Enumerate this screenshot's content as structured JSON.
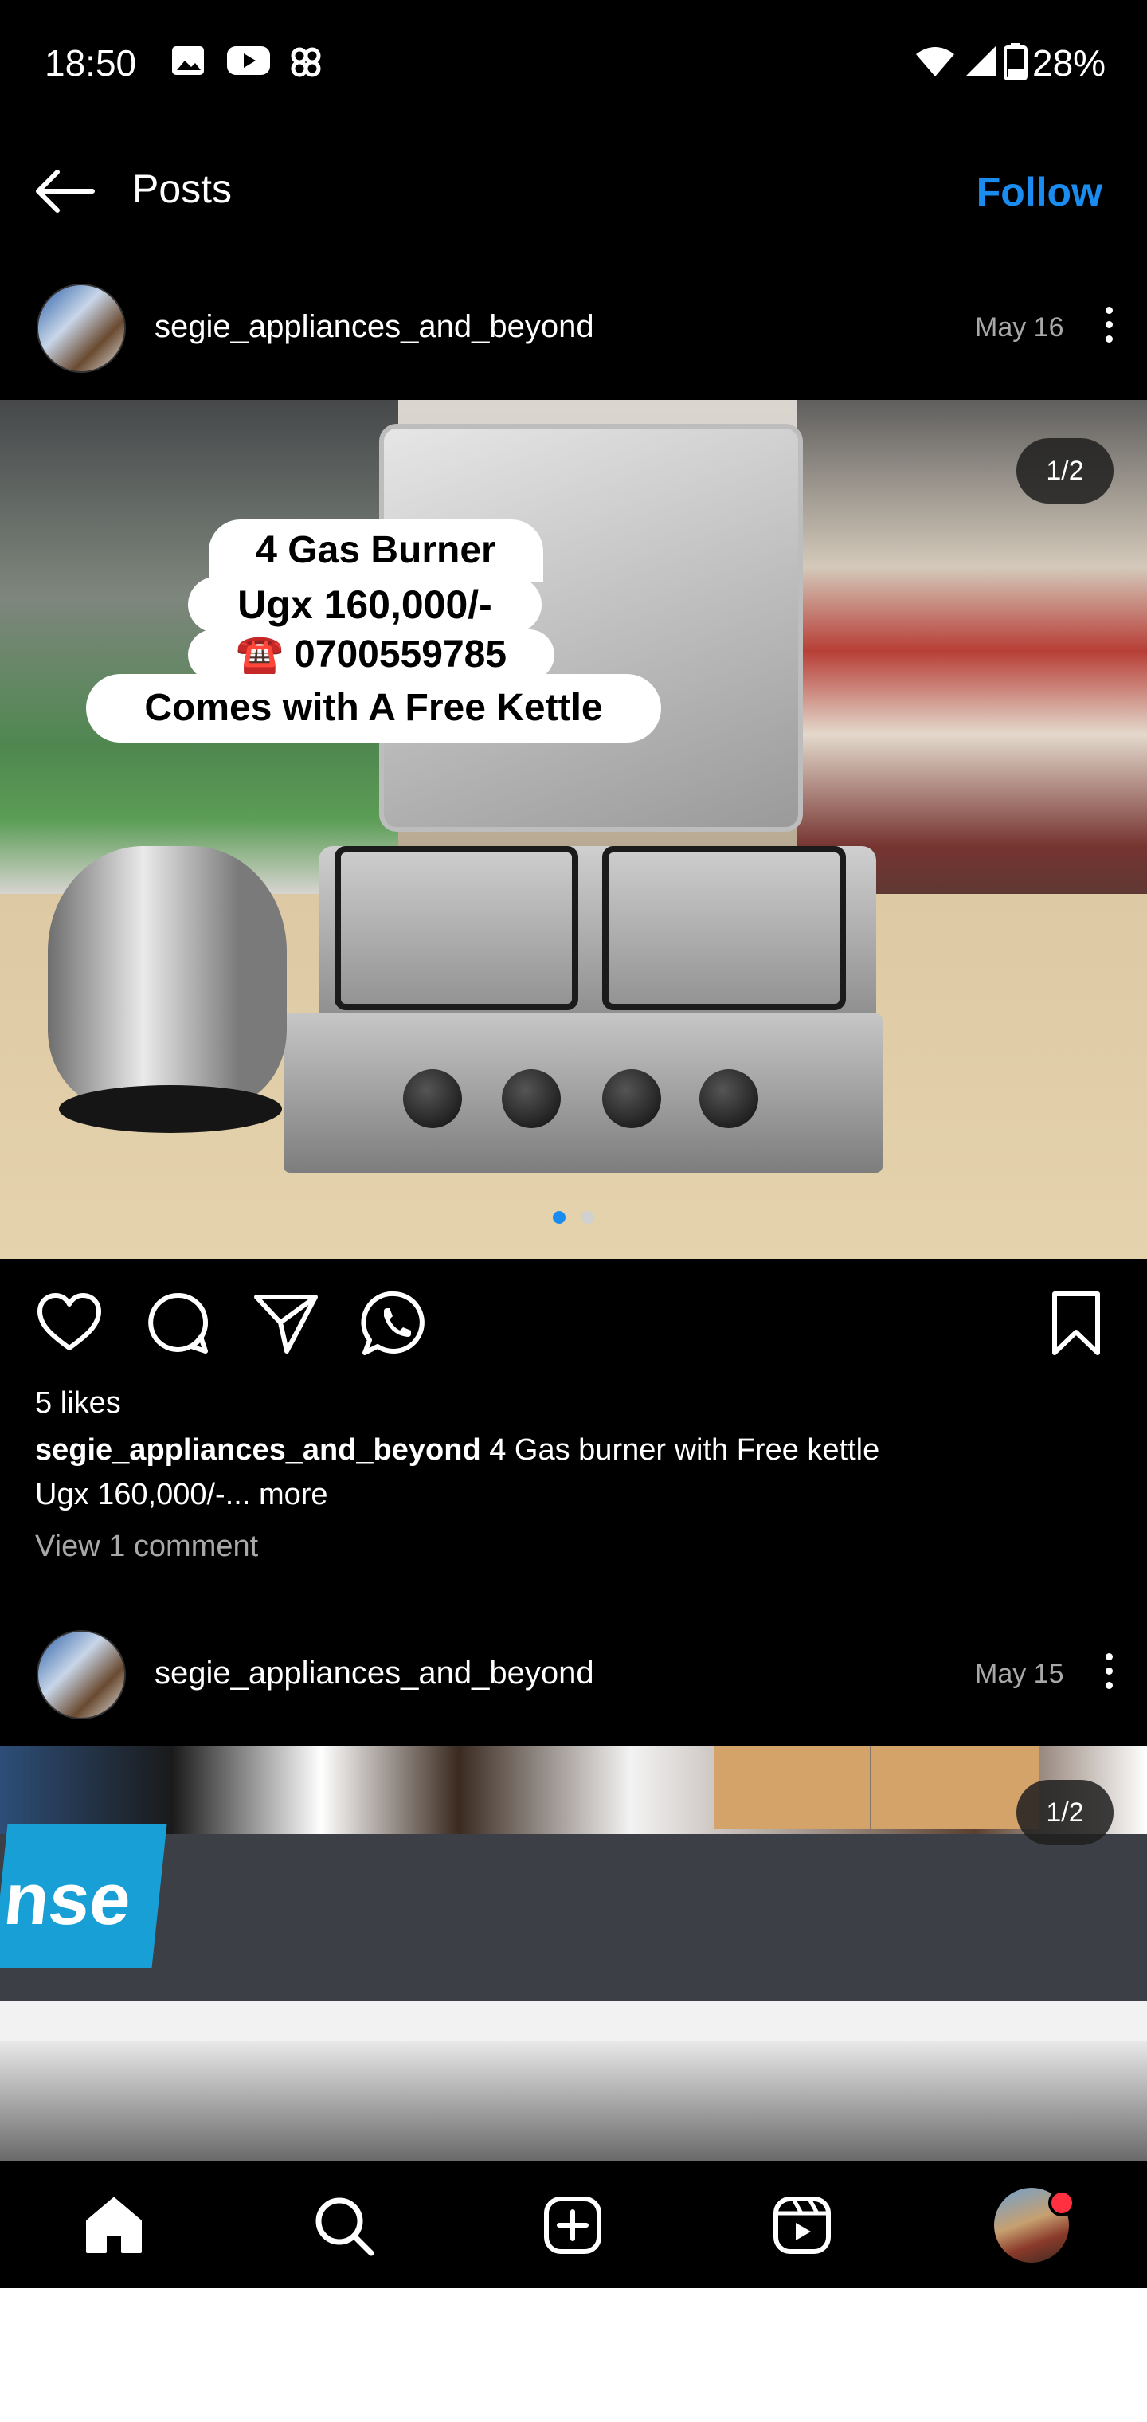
{
  "status_bar": {
    "time": "18:50",
    "battery": "28%",
    "icons": [
      "gallery-icon",
      "youtube-icon",
      "pinwheel-icon",
      "wifi-icon",
      "signal-icon",
      "battery-icon"
    ]
  },
  "header": {
    "title": "Posts",
    "follow_label": "Follow",
    "accent": "#1a8cf0"
  },
  "posts": [
    {
      "username": "segie_appliances_and_beyond",
      "date": "May 16",
      "counter": "1/2",
      "overlay_lines": [
        "4 Gas Burner",
        "Ugx 160,000/-",
        "☎️ 0700559785",
        "Comes with A Free Kettle"
      ],
      "likes": "5 likes",
      "caption_user": "segie_appliances_and_beyond",
      "caption_text": "4 Gas burner with Free kettle",
      "caption_text2": "Ugx 160,000/-...",
      "more_label": "more",
      "comments_label": "View 1 comment"
    },
    {
      "username": "segie_appliances_and_beyond",
      "date": "May 15",
      "counter": "1/2",
      "sign_text": "nse"
    }
  ],
  "carousel_dots": {
    "total": 2,
    "active": 1,
    "active_color": "#1a8cf0"
  },
  "bottom_nav": [
    "home-icon",
    "search-icon",
    "create-icon",
    "reels-icon",
    "profile-avatar"
  ]
}
